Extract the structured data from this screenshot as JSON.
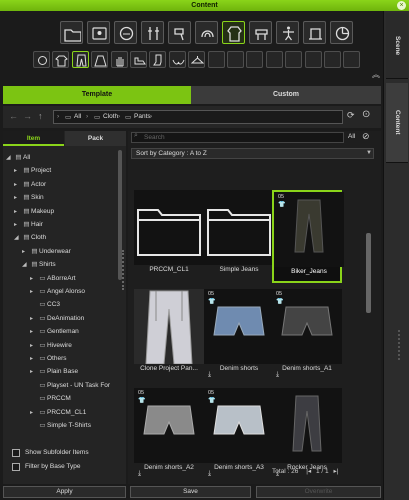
{
  "window": {
    "title": "Content",
    "side_tabs": [
      "Scene",
      "Content"
    ]
  },
  "toolbar_main": [
    {
      "icon": "folder-icon"
    },
    {
      "icon": "character-icon"
    },
    {
      "icon": "morph-icon"
    },
    {
      "icon": "accessory-icon"
    },
    {
      "icon": "hairdryer-icon"
    },
    {
      "icon": "hair-icon"
    },
    {
      "icon": "cloth-icon",
      "selected": true
    },
    {
      "icon": "prop-icon"
    },
    {
      "icon": "pose-icon"
    },
    {
      "icon": "stage-icon"
    },
    {
      "icon": "pie-icon"
    }
  ],
  "toolbar_sub": [
    {
      "icon": "head-icon"
    },
    {
      "icon": "shirt-icon"
    },
    {
      "icon": "pants-icon",
      "selected": true
    },
    {
      "icon": "skirt-icon"
    },
    {
      "icon": "glove-icon"
    },
    {
      "icon": "shoe-icon"
    },
    {
      "icon": "sock-icon"
    },
    {
      "icon": "bra-icon"
    },
    {
      "icon": "hanger-icon"
    },
    {
      "icon": "empty"
    },
    {
      "icon": "empty"
    },
    {
      "icon": "empty"
    },
    {
      "icon": "empty"
    },
    {
      "icon": "empty"
    },
    {
      "icon": "empty"
    },
    {
      "icon": "empty"
    },
    {
      "icon": "empty"
    }
  ],
  "tabs": {
    "template": "Template",
    "custom": "Custom"
  },
  "breadcrumb": [
    "All",
    "Cloth",
    "Pants"
  ],
  "left_tabs": {
    "item": "Item",
    "pack": "Pack"
  },
  "tree": [
    {
      "label": "All",
      "level": 0,
      "arrow": "◢"
    },
    {
      "label": "Project",
      "level": 1,
      "arrow": "▸"
    },
    {
      "label": "Actor",
      "level": 1,
      "arrow": "▸"
    },
    {
      "label": "Skin",
      "level": 1,
      "arrow": "▸"
    },
    {
      "label": "Makeup",
      "level": 1,
      "arrow": "▸"
    },
    {
      "label": "Hair",
      "level": 1,
      "arrow": "▸"
    },
    {
      "label": "Cloth",
      "level": 1,
      "arrow": "◢"
    },
    {
      "label": "Underwear",
      "level": 2,
      "arrow": "▸"
    },
    {
      "label": "Shirts",
      "level": 2,
      "arrow": "◢"
    },
    {
      "label": "ABorreArt",
      "level": 3,
      "arrow": "▸"
    },
    {
      "label": "Angel Alonso",
      "level": 3,
      "arrow": "▸"
    },
    {
      "label": "CC3",
      "level": 3,
      "arrow": ""
    },
    {
      "label": "DeAnimation",
      "level": 3,
      "arrow": "▸"
    },
    {
      "label": "Gentleman",
      "level": 3,
      "arrow": "▸"
    },
    {
      "label": "Hivewire",
      "level": 3,
      "arrow": "▸"
    },
    {
      "label": "Others",
      "level": 3,
      "arrow": "▸"
    },
    {
      "label": "Plain Base",
      "level": 3,
      "arrow": "▸"
    },
    {
      "label": "Playset - UN Task For",
      "level": 3,
      "arrow": ""
    },
    {
      "label": "PRCCM",
      "level": 3,
      "arrow": ""
    },
    {
      "label": "PRCCM_CL1",
      "level": 3,
      "arrow": "▸"
    },
    {
      "label": "Simple T-Shirts",
      "level": 3,
      "arrow": ""
    }
  ],
  "options": {
    "show_subfolder": "Show Subfolder Items",
    "filter_base": "Filter by Base Type"
  },
  "search": {
    "placeholder": "Search",
    "filter": "All"
  },
  "sort": {
    "value": "Sort by Category : A to Z"
  },
  "items": [
    {
      "label": "PRCCM_CL1",
      "kind": "folder"
    },
    {
      "label": "Simple Jeans",
      "kind": "folder"
    },
    {
      "label": "Biker_Jeans",
      "kind": "jeans-dark",
      "ver": "05",
      "selected": true
    },
    {
      "label": "Clone Project Pan...",
      "kind": "pants-white"
    },
    {
      "label": "Denim shorts",
      "kind": "shorts-blue",
      "ver": "05",
      "download": true
    },
    {
      "label": "Denim shorts_A1",
      "kind": "shorts-black",
      "ver": "05",
      "download": true
    },
    {
      "label": "Denim shorts_A2",
      "kind": "shorts-grey",
      "ver": "05",
      "download": true
    },
    {
      "label": "Denim shorts_A3",
      "kind": "shorts-light",
      "ver": "05",
      "download": true
    },
    {
      "label": "Rocker Jeans",
      "kind": "jeans-dark2",
      "download": true
    }
  ],
  "footer": {
    "total": "Total : 26",
    "page": "1",
    "page_total": "/ 1"
  },
  "buttons": {
    "apply": "Apply",
    "save": "Save",
    "overwrite": "Overwrite"
  },
  "colors": {
    "accent": "#8ad41a"
  }
}
